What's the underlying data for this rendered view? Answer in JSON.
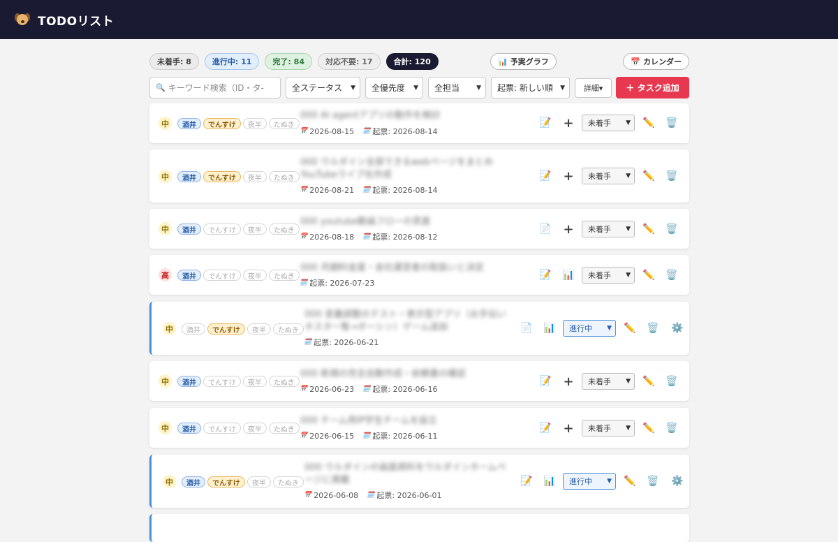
{
  "app": {
    "title": "TODOリスト"
  },
  "stats": [
    {
      "label": "未着手: 8",
      "kind": "notstarted"
    },
    {
      "label": "進行中: 11",
      "kind": "inprogress"
    },
    {
      "label": "完了: 84",
      "kind": "done"
    },
    {
      "label": "対応不要: 17",
      "kind": "na"
    },
    {
      "label": "合計: 120",
      "kind": "total"
    }
  ],
  "toolbar": {
    "graph_label": "予実グラフ",
    "calendar_label": "カレンダー",
    "search_placeholder": "キーワード検索（ID・タ‐",
    "status_filter": "全ステータス",
    "priority_filter": "全優先度",
    "assignee_filter": "全担当",
    "sort": "起票: 新しい順",
    "detail_label": "詳細▾",
    "add_label": "＋ タスク追加"
  },
  "assignees": [
    "酒井",
    "でんすけ",
    "夜半",
    "たぬき"
  ],
  "tasks": [
    {
      "priority": "中",
      "level": "mid",
      "active": [
        0,
        1
      ],
      "title": "000 AI agentアプリの動作を検討",
      "due": "2026-08-15",
      "created": "起票: 2026-08-14",
      "memo": "edit",
      "extra": "plus",
      "status": "未着手",
      "progress": false
    },
    {
      "priority": "中",
      "level": "mid",
      "active": [
        0,
        1
      ],
      "title": "000 ウルダイン全部できるwebページをまとめYouTubeライブ化作成",
      "due": "2026-08-21",
      "created": "起票: 2026-08-14",
      "memo": "edit",
      "extra": "plus",
      "status": "未着手",
      "progress": false
    },
    {
      "priority": "中",
      "level": "mid",
      "active": [
        0
      ],
      "title": "000 youtube動画フローの見直",
      "due": "2026-08-18",
      "created": "起票: 2026-08-12",
      "memo": "doc",
      "extra": "plus",
      "status": "未着手",
      "progress": false
    },
    {
      "priority": "高",
      "level": "high",
      "active": [
        0
      ],
      "title": "000 月額料金度・会社運営者の取扱いと決定",
      "due": "",
      "created": "起票: 2026-07-23",
      "memo": "edit",
      "extra": "chart",
      "status": "未着手",
      "progress": false
    },
    {
      "priority": "中",
      "level": "mid",
      "active": [
        1
      ],
      "title": "000 音量調整のテスト・表示型アプリ（お手伝いネスタ一覧→ボーシン）ゲーム追加",
      "due": "",
      "created": "起票: 2026-06-21",
      "memo": "doc",
      "extra": "chart",
      "status": "進行中",
      "progress": true
    },
    {
      "priority": "中",
      "level": "mid",
      "active": [
        0
      ],
      "title": "000 新規の完全自動作成・依頼書の確認",
      "due": "2026-06-23",
      "created": "起票: 2026-06-16",
      "memo": "edit",
      "extra": "plus",
      "status": "未着手",
      "progress": false
    },
    {
      "priority": "中",
      "level": "mid",
      "active": [
        0
      ],
      "title": "000 チーム用IP学生チームを設立",
      "due": "2026-06-15",
      "created": "起票: 2026-06-11",
      "memo": "edit",
      "extra": "plus",
      "status": "未着手",
      "progress": false
    },
    {
      "priority": "中",
      "level": "mid",
      "active": [
        0,
        1
      ],
      "title": "000 ウルダインの画面資料をウルダインホームページに掲載",
      "due": "2026-06-08",
      "created": "起票: 2026-06-01",
      "memo": "edit",
      "extra": "chart",
      "status": "進行中",
      "progress": true
    }
  ],
  "icons": {
    "logo": "dog-icon",
    "graph": "bar-chart-icon",
    "calendar": "calendar-icon",
    "search": "search-icon",
    "edit": "pencil-icon",
    "delete": "trash-icon",
    "settings": "gear-icon"
  },
  "colors": {
    "header": "#1a1b33",
    "add": "#e8384f",
    "progress": "#4a90d9"
  }
}
